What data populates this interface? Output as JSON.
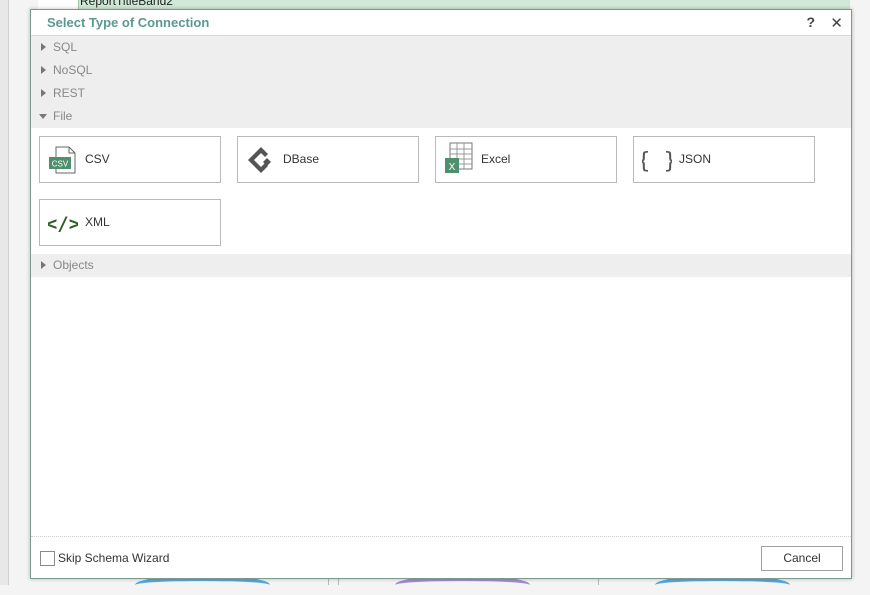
{
  "background": {
    "band_label": "ReportTitleBand2"
  },
  "dialog": {
    "title": "Select Type of Connection",
    "help_glyph": "?",
    "close_glyph": "✕",
    "groups": [
      {
        "label": "SQL",
        "expanded": false
      },
      {
        "label": "NoSQL",
        "expanded": false
      },
      {
        "label": "REST",
        "expanded": false
      },
      {
        "label": "File",
        "expanded": true
      },
      {
        "label": "Objects",
        "expanded": false
      }
    ],
    "file_items": [
      {
        "label": "CSV",
        "icon": "csv-file-icon",
        "icon_text": "CSV"
      },
      {
        "label": "DBase",
        "icon": "dbase-icon"
      },
      {
        "label": "Excel",
        "icon": "excel-file-icon",
        "icon_text": "X"
      },
      {
        "label": "JSON",
        "icon": "json-braces-icon",
        "icon_text": "{ }"
      },
      {
        "label": "XML",
        "icon": "xml-code-icon",
        "icon_text": "</>"
      }
    ],
    "footer": {
      "skip_wizard_label": "Skip Schema Wizard",
      "skip_wizard_checked": false,
      "cancel_label": "Cancel"
    },
    "colors": {
      "title": "#5a9a8e",
      "accent_green": "#3a7a5e",
      "excel_green": "#4f8f6e",
      "xml_dark_green": "#2e5e22"
    }
  }
}
